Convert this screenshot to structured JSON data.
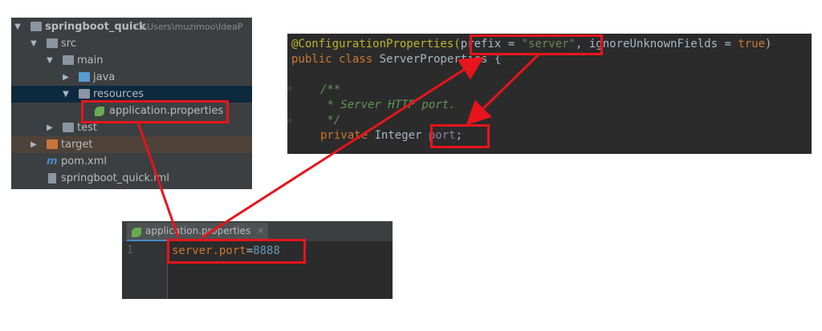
{
  "tree": {
    "project_name": "springboot_quick",
    "project_path": "C:\\Users\\muzimoo\\IdeaP",
    "items": [
      {
        "label": "src"
      },
      {
        "label": "main"
      },
      {
        "label": "java"
      },
      {
        "label": "resources"
      },
      {
        "label": "application.properties"
      },
      {
        "label": "test"
      },
      {
        "label": "target"
      },
      {
        "label": "pom.xml"
      },
      {
        "label": "springboot_quick.iml"
      }
    ]
  },
  "code": {
    "line1": {
      "annotation": "@ConfigurationProperties(",
      "prefix_key": "prefix = ",
      "prefix_val": "\"server\"",
      "rest": ", ignoreUnknownFields = ",
      "bool": "true",
      "close": ")"
    },
    "line2": {
      "kw": "public class ",
      "name": "ServerProperties {"
    },
    "line3": "",
    "line4": "/**",
    "line5": " * Server HTTP port.",
    "line6": " */",
    "line7": {
      "kw": "private ",
      "type": "Integer ",
      "field": "port",
      "semi": ";"
    }
  },
  "props": {
    "tab_label": "application.properties",
    "tab_close": "×",
    "line_number": "1",
    "key": "server.port",
    "eq": "=",
    "value": "8888"
  },
  "colors": {
    "highlight": "#e8141c",
    "accent": "#4a88c7"
  }
}
